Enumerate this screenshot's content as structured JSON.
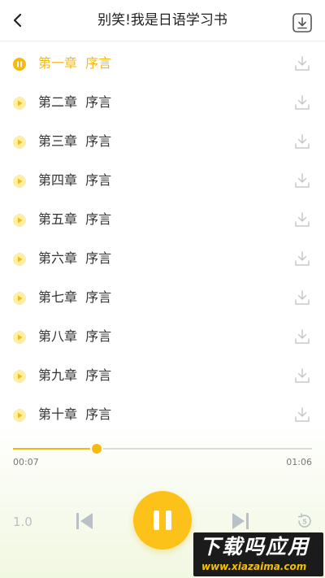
{
  "header": {
    "back_icon": "chevron-left-icon",
    "title": "别笑!我是日语学习书",
    "batch_download_icon": "download-box-icon"
  },
  "chapters": [
    {
      "label": "第一章  序言",
      "state": "playing"
    },
    {
      "label": "第二章  序言",
      "state": "idle"
    },
    {
      "label": "第三章  序言",
      "state": "idle"
    },
    {
      "label": "第四章  序言",
      "state": "idle"
    },
    {
      "label": "第五章  序言",
      "state": "idle"
    },
    {
      "label": "第六章  序言",
      "state": "idle"
    },
    {
      "label": "第七章  序言",
      "state": "idle"
    },
    {
      "label": "第八章  序言",
      "state": "idle"
    },
    {
      "label": "第九章  序言",
      "state": "idle"
    },
    {
      "label": "第十章  序言",
      "state": "idle"
    }
  ],
  "player": {
    "current_time": "00:07",
    "total_time": "01:06",
    "progress_fraction": 0.28,
    "speed_label": "1.0",
    "state": "playing"
  },
  "watermark": {
    "big": "下载吗应用",
    "small": "www.xiazaima.com"
  },
  "colors": {
    "accent": "#f5b90f",
    "accent_button": "#fcc21a",
    "text": "#333333",
    "muted": "#b8c0c8"
  }
}
